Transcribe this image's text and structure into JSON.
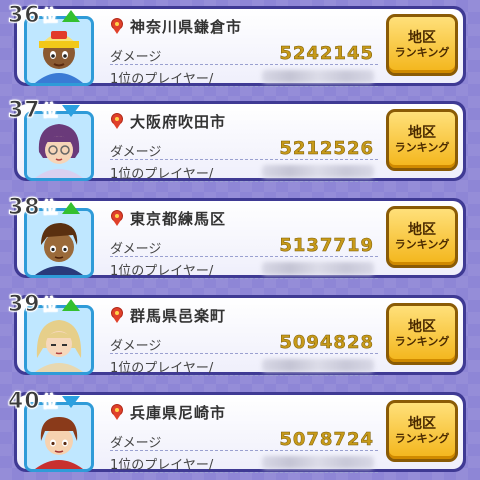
{
  "rows": [
    {
      "rank": "36",
      "rank_suffix": "位",
      "trend": "up",
      "city": "神奈川県鎌倉市",
      "damage_label": "ダメージ",
      "damage": "5242145",
      "top_player_label": "1位のプレイヤー/",
      "button_line1": "地区",
      "button_line2": "ランキング"
    },
    {
      "rank": "37",
      "rank_suffix": "位",
      "trend": "down",
      "city": "大阪府吹田市",
      "damage_label": "ダメージ",
      "damage": "5212526",
      "top_player_label": "1位のプレイヤー/",
      "button_line1": "地区",
      "button_line2": "ランキング"
    },
    {
      "rank": "38",
      "rank_suffix": "位",
      "trend": "up",
      "city": "東京都練馬区",
      "damage_label": "ダメージ",
      "damage": "5137719",
      "top_player_label": "1位のプレイヤー/",
      "button_line1": "地区",
      "button_line2": "ランキング"
    },
    {
      "rank": "39",
      "rank_suffix": "位",
      "trend": "up",
      "city": "群馬県邑楽町",
      "damage_label": "ダメージ",
      "damage": "5094828",
      "top_player_label": "1位のプレイヤー/",
      "button_line1": "地区",
      "button_line2": "ランキング"
    },
    {
      "rank": "40",
      "rank_suffix": "位",
      "trend": "down",
      "city": "兵庫県尼崎市",
      "damage_label": "ダメージ",
      "damage": "5078724",
      "top_player_label": "1位のプレイヤー/",
      "button_line1": "地区",
      "button_line2": "ランキング"
    }
  ],
  "colors": {
    "up_arrow": "#34c030",
    "down_arrow": "#2aa0e0",
    "damage_value": "#c79a1a",
    "button": "#f3b51a",
    "background": "#8e86d6"
  },
  "icons": {
    "trend_up": "green-up-arrow-icon",
    "trend_down": "blue-down-arrow-icon",
    "badge": "red-ribbon-medal-icon"
  }
}
